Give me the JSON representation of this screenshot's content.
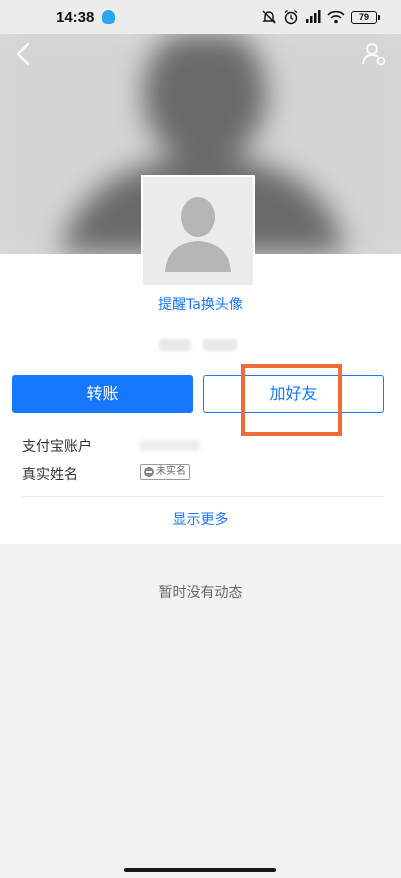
{
  "status_bar": {
    "time": "14:38",
    "battery": "79",
    "icons": [
      "qq-icon",
      "do-not-disturb-icon",
      "alarm-icon",
      "signal-icon",
      "wifi-icon",
      "battery-icon"
    ]
  },
  "header": {
    "back_icon": "chevron-left-icon",
    "profile_icon": "user-settings-icon"
  },
  "profile": {
    "remind_link": "提醒Ta换头像"
  },
  "actions": {
    "transfer_label": "转账",
    "add_friend_label": "加好友",
    "highlight_color": "#f06b3a"
  },
  "info": {
    "alipay_account_label": "支付宝账户",
    "real_name_label": "真实姓名",
    "unverified_badge": "未实名"
  },
  "show_more": "显示更多",
  "feed": {
    "empty_text": "暂时没有动态"
  },
  "colors": {
    "accent": "#1677ff",
    "highlight": "#f06b3a"
  }
}
